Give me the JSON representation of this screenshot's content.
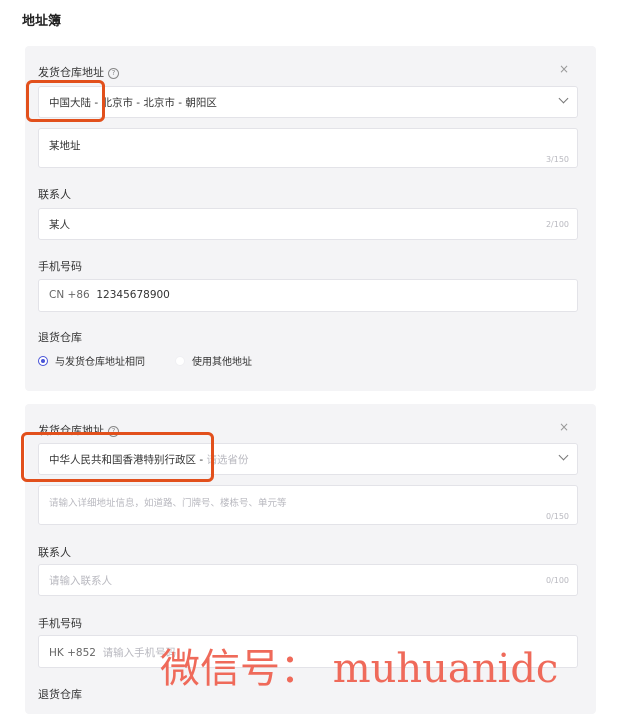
{
  "page": {
    "title": "地址簿"
  },
  "card1": {
    "warehouse_label": "发货仓库地址",
    "region_value": "中国大陆 - 北京市 - 北京市 - 朝阳区",
    "address_value": "某地址",
    "address_counter": "3/150",
    "contact_label": "联系人",
    "contact_value": "某人",
    "contact_counter": "2/100",
    "phone_label": "手机号码",
    "phone_prefix": "CN +86",
    "phone_value": "12345678900",
    "return_label": "退货仓库",
    "radio_same": "与发货仓库地址相同",
    "radio_other": "使用其他地址"
  },
  "card2": {
    "warehouse_label": "发货仓库地址",
    "region_value": "中华人民共和国香港特别行政区 - ",
    "region_placeholder": "请选省份",
    "address_placeholder": "请输入详细地址信息，如道路、门牌号、楼栋号、单元等",
    "address_counter": "0/150",
    "contact_label": "联系人",
    "contact_placeholder": "请输入联系人",
    "contact_counter": "0/100",
    "phone_label": "手机号码",
    "phone_prefix": "HK +852",
    "phone_placeholder": "请输入手机号码",
    "return_label": "退货仓库"
  },
  "icons": {
    "close": "×",
    "info": "?"
  },
  "colors": {
    "highlight": "#e2501c",
    "radio_accent": "#4a55d8",
    "watermark": "#ef6a5a"
  },
  "watermark": {
    "text": "微信号： muhuanidc"
  }
}
